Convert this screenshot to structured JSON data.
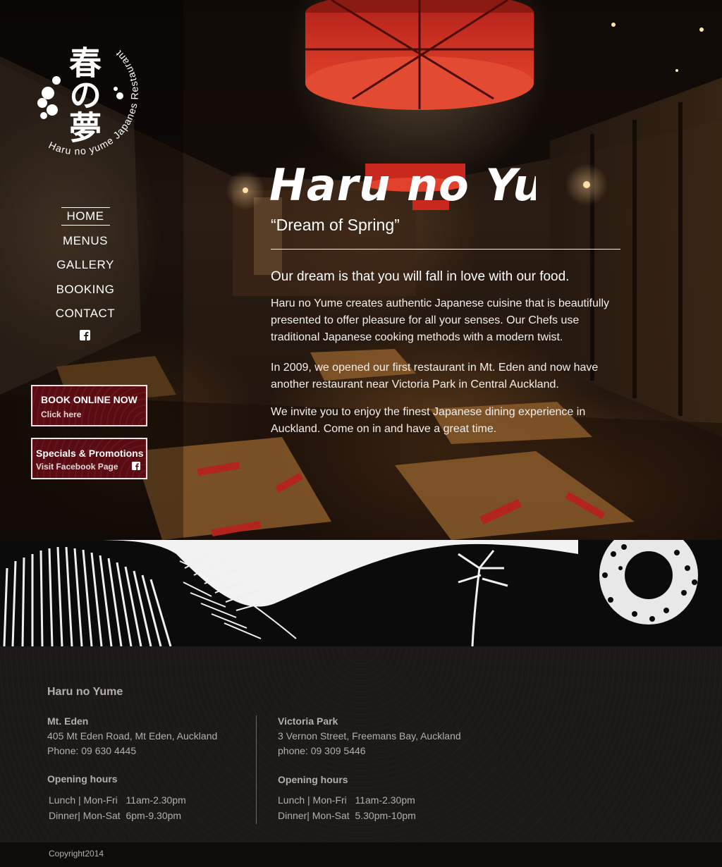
{
  "logo": {
    "kanji": "春の夢",
    "arc_text": "Haru no yume Japanes Restaurant"
  },
  "nav": {
    "items": [
      {
        "label": "HOME",
        "active": true
      },
      {
        "label": "MENUS"
      },
      {
        "label": "GALLERY"
      },
      {
        "label": "BOOKING"
      },
      {
        "label": "CONTACT"
      }
    ],
    "facebook_icon": "facebook-icon"
  },
  "promos": {
    "book": {
      "title": "BOOK ONLINE NOW",
      "subtitle": "Click here"
    },
    "specials": {
      "title": "Specials & Promotions",
      "subtitle": "Visit Facebook Page",
      "icon": "facebook-icon"
    }
  },
  "hero": {
    "brand": "Haru no Yume",
    "tagline": "“Dream of Spring”",
    "lead": "Our dream is that you will fall in love with our food.",
    "paragraphs": [
      "Haru no Yume creates authentic Japanese cuisine that is beautifully presented to offer pleasure for all your senses. Our Chefs use traditional Japanese cooking methods with a modern twist.",
      "In 2009, we opened our first restaurant in Mt. Eden and now have another restaurant near Victoria Park in Central Auckland.",
      "We invite you to enjoy the finest Japanese dining experience in Auckland. Come on in and have a great time."
    ]
  },
  "footer": {
    "title": "Haru no Yume",
    "locations": [
      {
        "name": "Mt. Eden",
        "address": "405 Mt Eden Road, Mt Eden, Auckland",
        "phone": "Phone: 09 630 4445",
        "hours_heading": "Opening hours",
        "hours": [
          "Lunch | Mon-Fri   11am-2.30pm",
          "Dinner| Mon-Sat  6pm-9.30pm"
        ]
      },
      {
        "name": "Victoria Park",
        "address": "3 Vernon Street, Freemans Bay, Auckland",
        "phone": "phone: 09 309 5446",
        "hours_heading": "Opening hours",
        "hours": [
          "Lunch | Mon-Fri   11am-2.30pm",
          "Dinner| Mon-Sat  5.30pm-10pm"
        ]
      }
    ],
    "copyright": "Copyright2014"
  },
  "colors": {
    "accent_red": "#5a0c12",
    "lamp_red": "#c8281e",
    "footer_text": "#b4afab"
  }
}
